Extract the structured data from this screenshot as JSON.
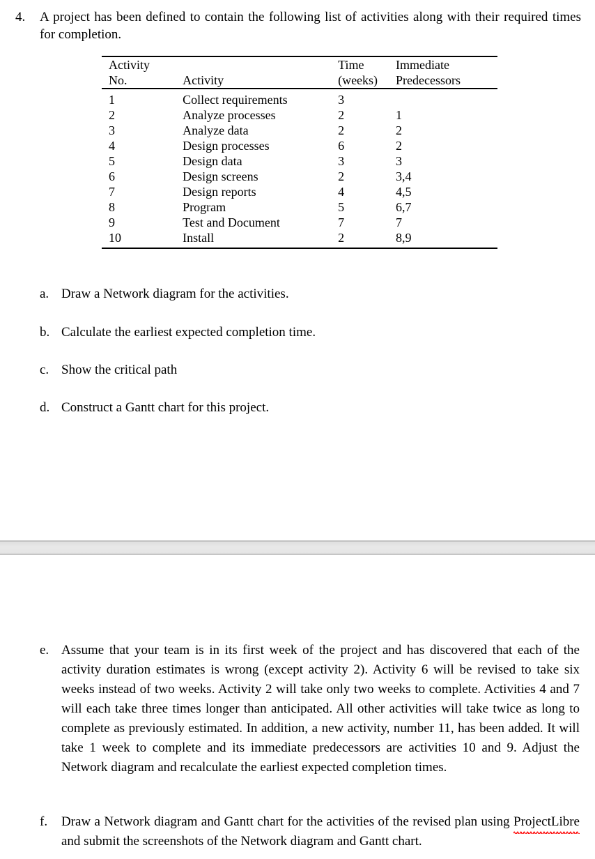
{
  "question": {
    "number": "4.",
    "text": "A project has been defined to contain the following list of activities along with their required times for completion."
  },
  "table": {
    "headers": {
      "activity_no_line1": "Activity",
      "activity_no_line2": "No.",
      "activity_line1": "",
      "activity_line2": "Activity",
      "time_line1": "Time",
      "time_line2": "(weeks)",
      "predecessors_line1": "Immediate",
      "predecessors_line2": "Predecessors"
    },
    "rows": [
      {
        "no": "1",
        "activity": "Collect requirements",
        "time": "3",
        "predecessors": ""
      },
      {
        "no": "2",
        "activity": "Analyze processes",
        "time": "2",
        "predecessors": "1"
      },
      {
        "no": "3",
        "activity": "Analyze data",
        "time": "2",
        "predecessors": "2"
      },
      {
        "no": "4",
        "activity": "Design processes",
        "time": "6",
        "predecessors": "2"
      },
      {
        "no": "5",
        "activity": "Design data",
        "time": "3",
        "predecessors": "3"
      },
      {
        "no": "6",
        "activity": "Design screens",
        "time": "2",
        "predecessors": "3,4"
      },
      {
        "no": "7",
        "activity": "Design reports",
        "time": "4",
        "predecessors": "4,5"
      },
      {
        "no": "8",
        "activity": "Program",
        "time": "5",
        "predecessors": "6,7"
      },
      {
        "no": "9",
        "activity": "Test and Document",
        "time": "7",
        "predecessors": "7"
      },
      {
        "no": "10",
        "activity": "Install",
        "time": "2",
        "predecessors": "8,9"
      }
    ]
  },
  "subitems": {
    "a": {
      "marker": "a.",
      "text": "Draw a Network diagram for the activities."
    },
    "b": {
      "marker": "b.",
      "text": "Calculate the earliest expected completion time."
    },
    "c": {
      "marker": "c.",
      "text": "Show the critical path"
    },
    "d": {
      "marker": "d.",
      "text": "Construct a Gantt chart for this project."
    },
    "e": {
      "marker": "e.",
      "text": "Assume that your team is in its first week of the project and has discovered that each of the activity duration estimates is wrong (except activity 2). Activity 6 will be revised to take six weeks instead of two weeks. Activity 2 will take only two weeks to complete.  Activities 4 and 7 will each take three times longer than anticipated. All other activities will take twice as long to complete as previously estimated.  In addition, a new activity, number 11, has been added.  It will take 1 week to complete and its immediate predecessors are activities 10 and 9.  Adjust the Network diagram and recalculate the earliest expected completion times."
    },
    "f": {
      "marker": "f.",
      "text_before": "Draw a Network diagram and Gantt chart for the activities of the revised plan using ",
      "misspelled_word": "ProjectLibre",
      "text_after": " and submit the screenshots of the Network diagram and Gantt chart."
    }
  },
  "colors": {
    "text": "#000000",
    "page_background": "#ffffff",
    "page_band": "#e6e6e6",
    "page_band_border": "#c2c2c2",
    "spellcheck_underline": "#ff0000",
    "table_rule": "#000000"
  }
}
